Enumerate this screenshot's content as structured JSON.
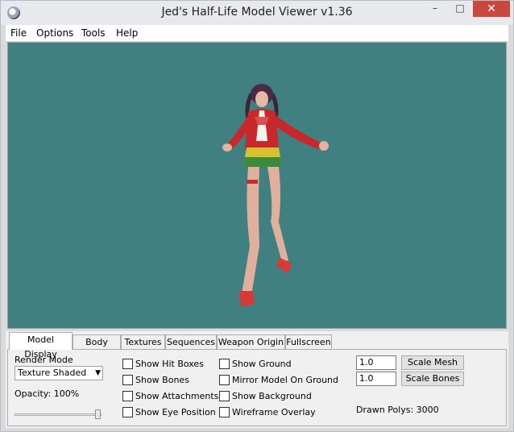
{
  "window": {
    "title": "Jed's Half-Life Model Viewer v1.36"
  },
  "menu": {
    "items": [
      "File",
      "Options",
      "Tools",
      "Help"
    ]
  },
  "viewport": {
    "background": "#408080",
    "model_icon": "character-model"
  },
  "tabs": [
    "Model Display",
    "Body Parts",
    "Textures",
    "Sequences",
    "Weapon Origin",
    "Fullscreen"
  ],
  "model_display": {
    "render_mode_label": "Render Mode",
    "render_mode_value": "Texture Shaded",
    "opacity_label": "Opacity: 100%",
    "opacity": 1.0,
    "checkboxes_col1": [
      "Show Hit Boxes",
      "Show Bones",
      "Show Attachments",
      "Show Eye Position"
    ],
    "checkboxes_col2": [
      "Show Ground",
      "Mirror Model On Ground",
      "Show Background",
      "Wireframe Overlay"
    ],
    "scale_mesh_value": "1.0",
    "scale_mesh_label": "Scale Mesh",
    "scale_bones_value": "1.0",
    "scale_bones_label": "Scale Bones",
    "drawn_polys": "Drawn Polys: 3000"
  }
}
